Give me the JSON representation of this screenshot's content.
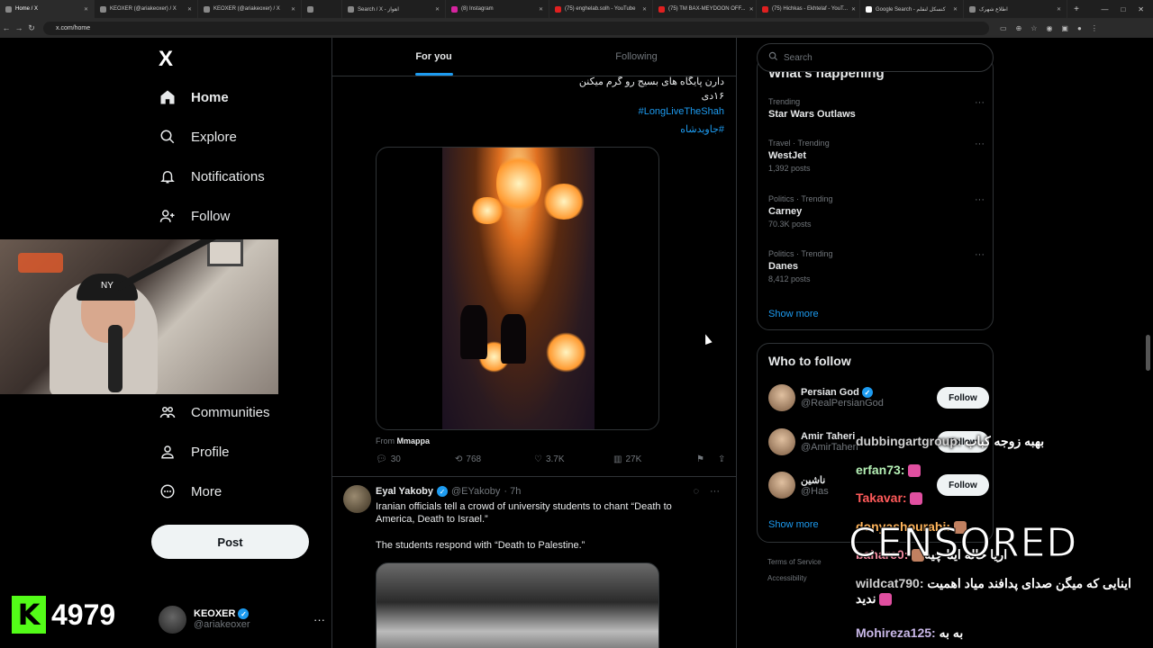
{
  "browser": {
    "tabs": [
      {
        "label": "Home / X",
        "icon": "x-icon",
        "active": true
      },
      {
        "label": "KEOXER (@ariakeoxer) / X",
        "icon": "x-icon"
      },
      {
        "label": "KEOXER (@ariakeoxer) / X",
        "icon": "x-icon"
      },
      {
        "label": "",
        "icon": "x-icon"
      },
      {
        "label": "Search / X - اهواز",
        "icon": "x-icon"
      },
      {
        "label": "(8) Instagram",
        "icon": "instagram-icon"
      },
      {
        "label": "(75) enghelab.solh - YouTube",
        "icon": "youtube-icon"
      },
      {
        "label": "(75) TM BAX-MEYDOON OFF...",
        "icon": "youtube-icon"
      },
      {
        "label": "(75) Hichkas - Ekhtelaf - YouT...",
        "icon": "youtube-icon"
      },
      {
        "label": "Google Search - کنسکل لنقلم",
        "icon": "google-icon"
      },
      {
        "label": "اطلاع شهرک",
        "icon": "globe-icon"
      }
    ],
    "url": "x.com/home"
  },
  "sidebar": {
    "logo": "X",
    "items": [
      {
        "label": "Home",
        "icon": "home-icon"
      },
      {
        "label": "Explore",
        "icon": "search-icon"
      },
      {
        "label": "Notifications",
        "icon": "bell-icon"
      },
      {
        "label": "Follow",
        "icon": "follow-icon"
      },
      {
        "label": "Communities",
        "icon": "communities-icon"
      },
      {
        "label": "Profile",
        "icon": "profile-icon"
      },
      {
        "label": "More",
        "icon": "more-circle-icon"
      }
    ],
    "post_label": "Post",
    "account": {
      "name": "KEOXER",
      "handle": "@ariakeoxer"
    }
  },
  "overlay": {
    "kick_logo": "K",
    "viewer_count": "4979"
  },
  "feed": {
    "tabs": [
      {
        "label": "For you"
      },
      {
        "label": "Following"
      }
    ],
    "tweet1": {
      "text_line1": "دارن پایگاه های بسیج رو گرم میکنن",
      "text_line2": "۱۶دی",
      "hashtag1": "#LongLiveTheShah",
      "hashtag2": "#جاویدشاه",
      "from_label": "From",
      "from_source": "Mmappa",
      "replies": "30",
      "reposts": "768",
      "likes": "3.7K",
      "views": "27K"
    },
    "tweet2": {
      "name": "Eyal Yakoby",
      "handle": "@EYakoby",
      "time": "· 7h",
      "text1": "Iranian officials tell a crowd of university students to chant “Death to America, Death to Israel.”",
      "text2": "The students respond with “Death to Palestine.”"
    }
  },
  "right": {
    "search_placeholder": "Search",
    "happening_title": "What’s happening",
    "trends": [
      {
        "meta": "Trending",
        "name": "Star Wars Outlaws",
        "count": ""
      },
      {
        "meta": "Travel · Trending",
        "name": "WestJet",
        "count": "1,392 posts"
      },
      {
        "meta": "Politics · Trending",
        "name": "Carney",
        "count": "70.3K posts"
      },
      {
        "meta": "Politics · Trending",
        "name": "Danes",
        "count": "8,412 posts"
      }
    ],
    "show_more": "Show more",
    "who_title": "Who to follow",
    "who": [
      {
        "name": "Persian God",
        "handle": "@RealPersianGod",
        "button": "Follow"
      },
      {
        "name": "Amir Taheri",
        "handle": "@AmirTaheri",
        "button": "Follow"
      },
      {
        "name": "ناشین",
        "handle": "@Has",
        "button": "Follow"
      }
    ],
    "show_more2": "Show more",
    "footer1": "Terms of Service",
    "footer2": "Accessibility"
  },
  "chat": {
    "lines": [
      {
        "user": "dubbingartgroup:",
        "msg": "بهبه زوجه کباب"
      },
      {
        "user": "erfan73:",
        "msg": ""
      },
      {
        "user": "Takavar:",
        "msg": ""
      },
      {
        "user": "donyashourabi:",
        "msg": ""
      },
      {
        "user": "bahare0:",
        "msg": "اریا خاله اینا چیه"
      },
      {
        "user": "wildcat790:",
        "msg": "اینایی که میگن صدای پدافند میاد اهمیت ندید"
      },
      {
        "user": "Mohireza125:",
        "msg": "به به"
      }
    ],
    "censored": "CENSORED"
  }
}
